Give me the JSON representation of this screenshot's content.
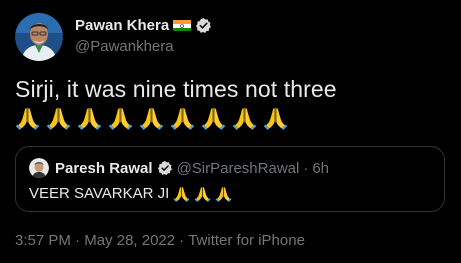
{
  "tweet": {
    "author": {
      "name": "Pawan Khera",
      "handle": "@Pawankhera",
      "flag_icon": "india-flag-icon",
      "verified_icon": "verified-badge-icon"
    },
    "text": "Sirji, it was nine times not three",
    "emoji_icon": "folded-hands-emoji",
    "emoji_count": 9,
    "quoted": {
      "name": "Paresh Rawal",
      "handle": "@SirPareshRawal",
      "separator": "·",
      "time_ago": "6h",
      "text": "VEER SAVARKAR JI",
      "emoji_count": 3
    },
    "footer": {
      "time": "3:57 PM",
      "sep1": "·",
      "date": "May 28, 2022",
      "sep2": "·",
      "source": "Twitter for iPhone"
    }
  },
  "colors": {
    "background": "#000000",
    "text_primary": "#e7e9ea",
    "text_secondary": "#71767b",
    "border": "#2f3336",
    "verified": "#d9d9d9"
  }
}
